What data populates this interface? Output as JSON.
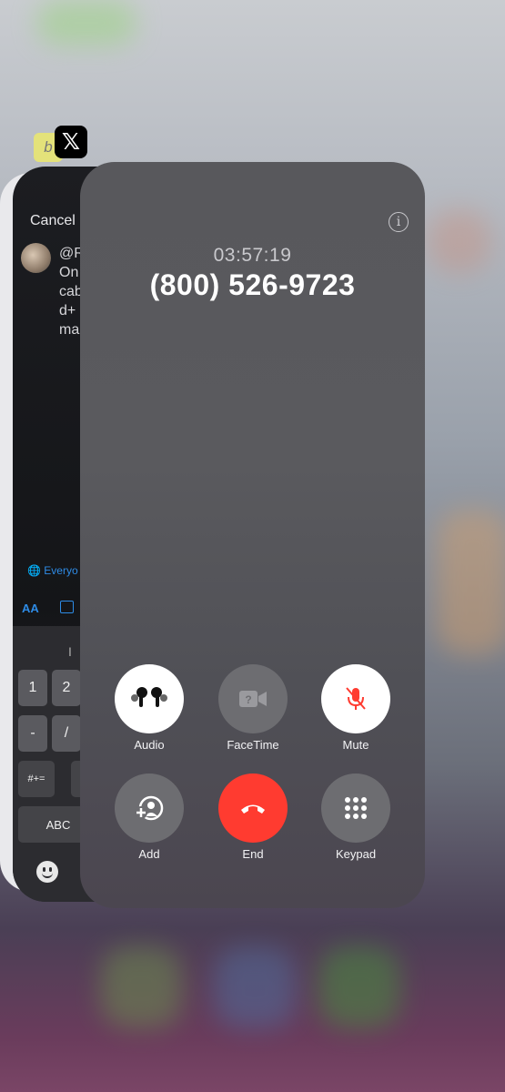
{
  "call": {
    "timer": "03:57:19",
    "phone_number": "(800) 526-9723",
    "buttons": {
      "audio": "Audio",
      "facetime": "FaceTime",
      "mute": "Mute",
      "add": "Add",
      "end": "End",
      "keypad": "Keypad"
    }
  },
  "x_app": {
    "cancel": "Cancel",
    "tweet_lines": [
      "@R",
      "On",
      "cab",
      "d+",
      "ma"
    ],
    "audience": "Everyo",
    "aa": "AA",
    "keyboard": {
      "cursor": "I",
      "k1": "1",
      "k2": "2",
      "minus": "-",
      "slash": "/",
      "symbols": "#+=",
      "abc": "ABC"
    }
  },
  "colors": {
    "end_call": "#ff3b30",
    "mute_icon": "#ff3b30",
    "x_accent": "#2e8be5"
  },
  "icons": [
    "airpods-icon",
    "facetime-icon",
    "mute-mic-icon",
    "add-call-icon",
    "end-call-icon",
    "keypad-icon",
    "info-icon",
    "emoji-icon",
    "image-icon",
    "globe-icon"
  ]
}
